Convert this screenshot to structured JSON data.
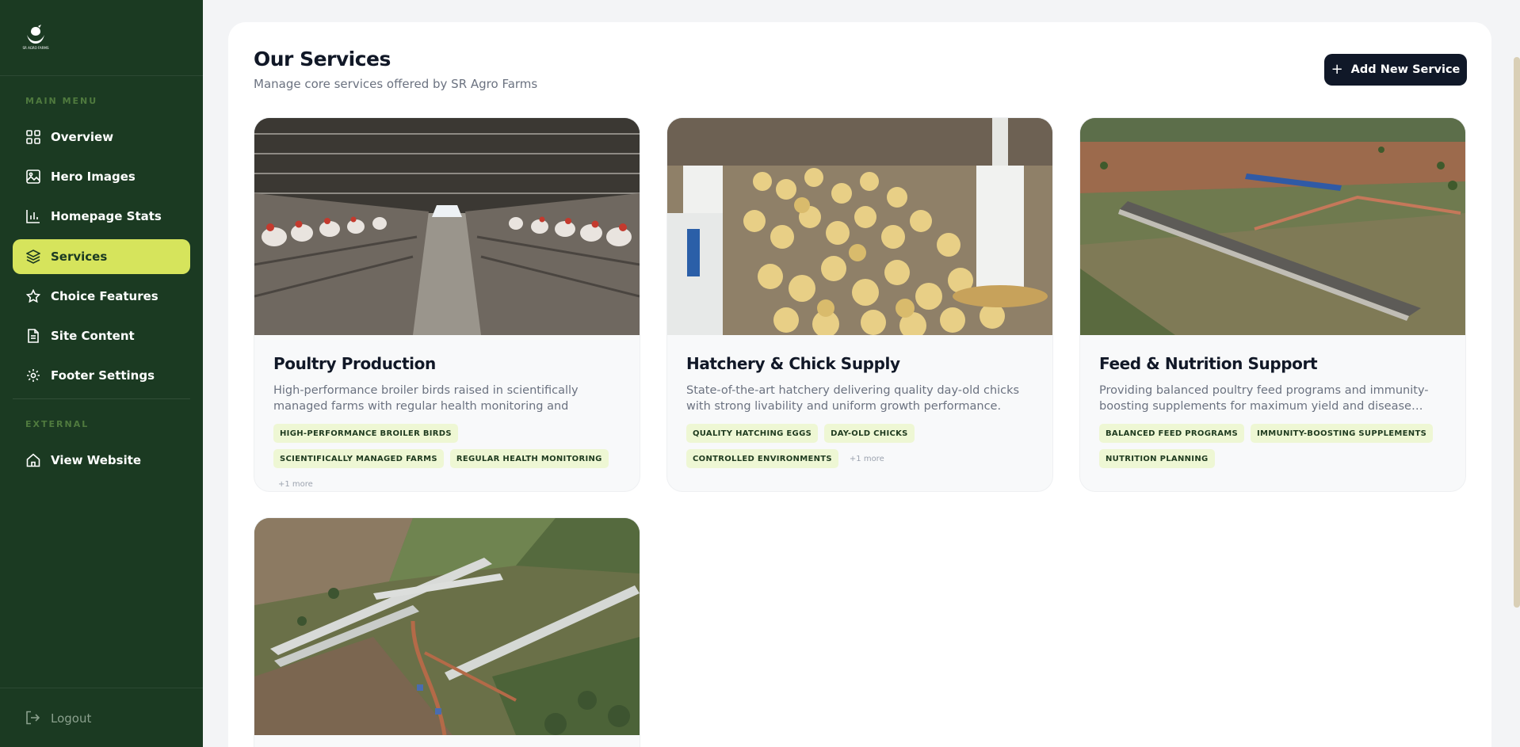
{
  "sidebar": {
    "logo_text": "SR AGRO FARMS",
    "main_menu_label": "MAIN MENU",
    "items": [
      {
        "label": "Overview",
        "icon": "grid-icon"
      },
      {
        "label": "Hero Images",
        "icon": "image-icon"
      },
      {
        "label": "Homepage Stats",
        "icon": "bar-chart-icon"
      },
      {
        "label": "Services",
        "icon": "layers-icon",
        "active": true
      },
      {
        "label": "Choice Features",
        "icon": "star-icon"
      },
      {
        "label": "Site Content",
        "icon": "document-icon"
      },
      {
        "label": "Footer Settings",
        "icon": "gear-icon"
      }
    ],
    "external_label": "EXTERNAL",
    "view_website": "View Website",
    "logout": "Logout"
  },
  "header": {
    "title": "Our Services",
    "subtitle": "Manage core services offered by SR Agro Farms",
    "add_button": "Add New Service"
  },
  "services": [
    {
      "title": "Poultry Production",
      "description": "High-performance broiler birds raised in scientifically managed farms with regular health monitoring and optimize…",
      "tags": [
        "HIGH-PERFORMANCE BROILER BIRDS",
        "SCIENTIFICALLY MANAGED FARMS",
        "REGULAR HEALTH MONITORING"
      ],
      "more": "+1 more"
    },
    {
      "title": "Hatchery & Chick Supply",
      "description": "State-of-the-art hatchery delivering quality day-old chicks with strong livability and uniform growth performance.",
      "tags": [
        "QUALITY HATCHING EGGS",
        "DAY-OLD CHICKS",
        "CONTROLLED ENVIRONMENTS"
      ],
      "more": "+1 more"
    },
    {
      "title": "Feed & Nutrition Support",
      "description": "Providing balanced poultry feed programs and immunity-boosting supplements for maximum yield and disease…",
      "tags": [
        "BALANCED FEED PROGRAMS",
        "IMMUNITY-BOOSTING SUPPLEMENTS",
        "NUTRITION PLANNING"
      ],
      "more": ""
    }
  ],
  "colors": {
    "sidebar_bg": "#1b3a22",
    "active_bg": "#d6e45c",
    "button_bg": "#101828",
    "tag_bg": "#eef7d4"
  }
}
